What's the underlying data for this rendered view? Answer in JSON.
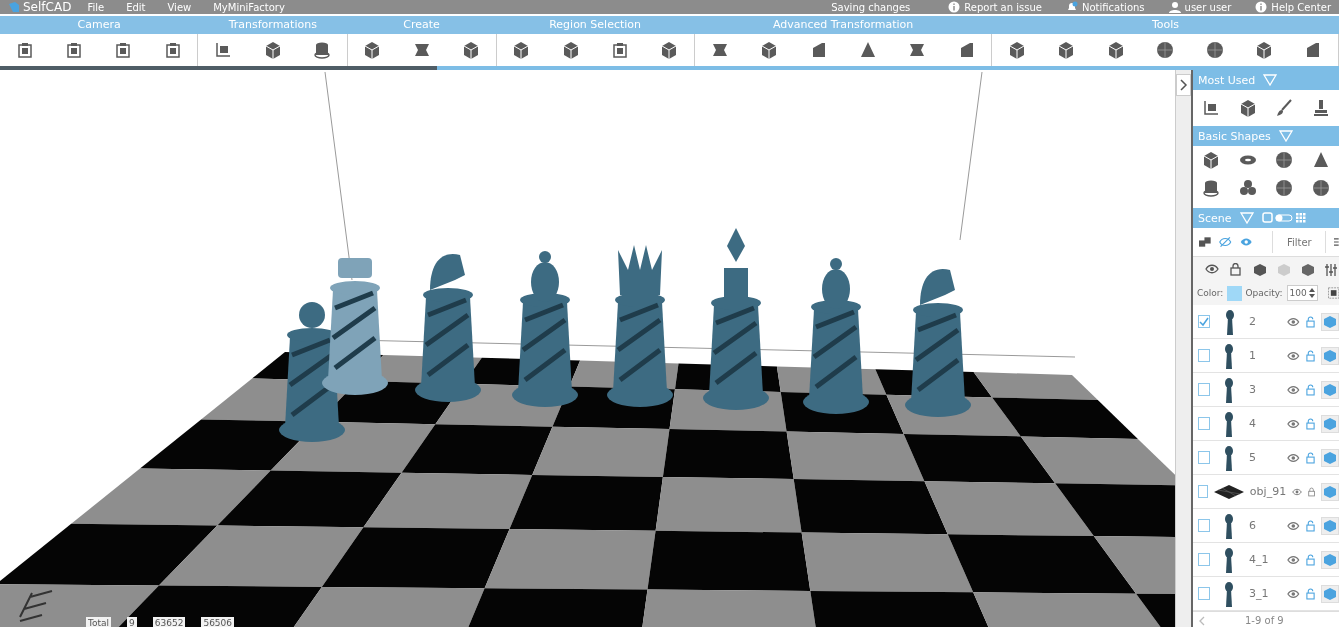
{
  "topbar": {
    "logo": "SelfCAD",
    "menus": [
      "File",
      "Edit",
      "View",
      "MyMiniFactory"
    ],
    "status": "Saving changes",
    "links": [
      {
        "kind": "info",
        "label": "Report an issue"
      },
      {
        "kind": "bell",
        "label": "Notifications"
      },
      {
        "kind": "user",
        "label": "user user"
      },
      {
        "kind": "info",
        "label": "Help Center"
      }
    ]
  },
  "toolbar": [
    {
      "label": "Camera",
      "tools": [
        {
          "kind": "frame"
        },
        {
          "kind": "frame"
        },
        {
          "kind": "frame"
        },
        {
          "kind": "frame"
        }
      ]
    },
    {
      "label": "Transformations",
      "tools": [
        {
          "kind": "axes"
        },
        {
          "kind": "cube"
        },
        {
          "kind": "cylinder"
        }
      ]
    },
    {
      "label": "Create",
      "tools": [
        {
          "kind": "cube"
        },
        {
          "kind": "slab"
        },
        {
          "kind": "cube"
        }
      ]
    },
    {
      "label": "Region Selection",
      "tools": [
        {
          "kind": "cube"
        },
        {
          "kind": "cube"
        },
        {
          "kind": "frame"
        },
        {
          "kind": "cube"
        }
      ]
    },
    {
      "label": "Advanced Transformation",
      "tools": [
        {
          "kind": "slab"
        },
        {
          "kind": "cube"
        },
        {
          "kind": "wedge"
        },
        {
          "kind": "cone"
        },
        {
          "kind": "slab"
        },
        {
          "kind": "wedge"
        }
      ]
    },
    {
      "label": "Tools",
      "tools": [
        {
          "kind": "cube"
        },
        {
          "kind": "cube"
        },
        {
          "kind": "cube"
        },
        {
          "kind": "sphere"
        },
        {
          "kind": "sphere"
        },
        {
          "kind": "cube"
        },
        {
          "kind": "wedge"
        }
      ]
    }
  ],
  "panel": {
    "most_used": {
      "title": "Most Used",
      "tools": [
        {
          "kind": "axes"
        },
        {
          "kind": "cube"
        },
        {
          "kind": "brush"
        },
        {
          "kind": "stamp"
        }
      ]
    },
    "basic_shapes": {
      "title": "Basic Shapes",
      "tools": [
        {
          "kind": "cube"
        },
        {
          "kind": "torus"
        },
        {
          "kind": "sphere"
        },
        {
          "kind": "cone"
        },
        {
          "kind": "cylinder"
        },
        {
          "kind": "knot"
        },
        {
          "kind": "sphere"
        },
        {
          "kind": "sphere"
        }
      ]
    },
    "scene": {
      "title": "Scene",
      "filter_placeholder": "Filter",
      "color_label": "Color:",
      "color": "#9fd8f7",
      "opacity_label": "Opacity:",
      "opacity": "100",
      "objects": [
        {
          "name": "2",
          "checked": true,
          "locked": false,
          "kind": "piece"
        },
        {
          "name": "1",
          "checked": false,
          "locked": false,
          "kind": "piece"
        },
        {
          "name": "3",
          "checked": false,
          "locked": false,
          "kind": "piece"
        },
        {
          "name": "4",
          "checked": false,
          "locked": false,
          "kind": "piece"
        },
        {
          "name": "5",
          "checked": false,
          "locked": false,
          "kind": "piece"
        },
        {
          "name": "obj_91",
          "checked": false,
          "locked": true,
          "kind": "board"
        },
        {
          "name": "6",
          "checked": false,
          "locked": false,
          "kind": "piece"
        },
        {
          "name": "4_1",
          "checked": false,
          "locked": false,
          "kind": "piece"
        },
        {
          "name": "3_1",
          "checked": false,
          "locked": false,
          "kind": "piece"
        }
      ],
      "pager": "1-9 of 9"
    }
  },
  "stats": [
    "Total",
    "9",
    "63652",
    "56506"
  ]
}
